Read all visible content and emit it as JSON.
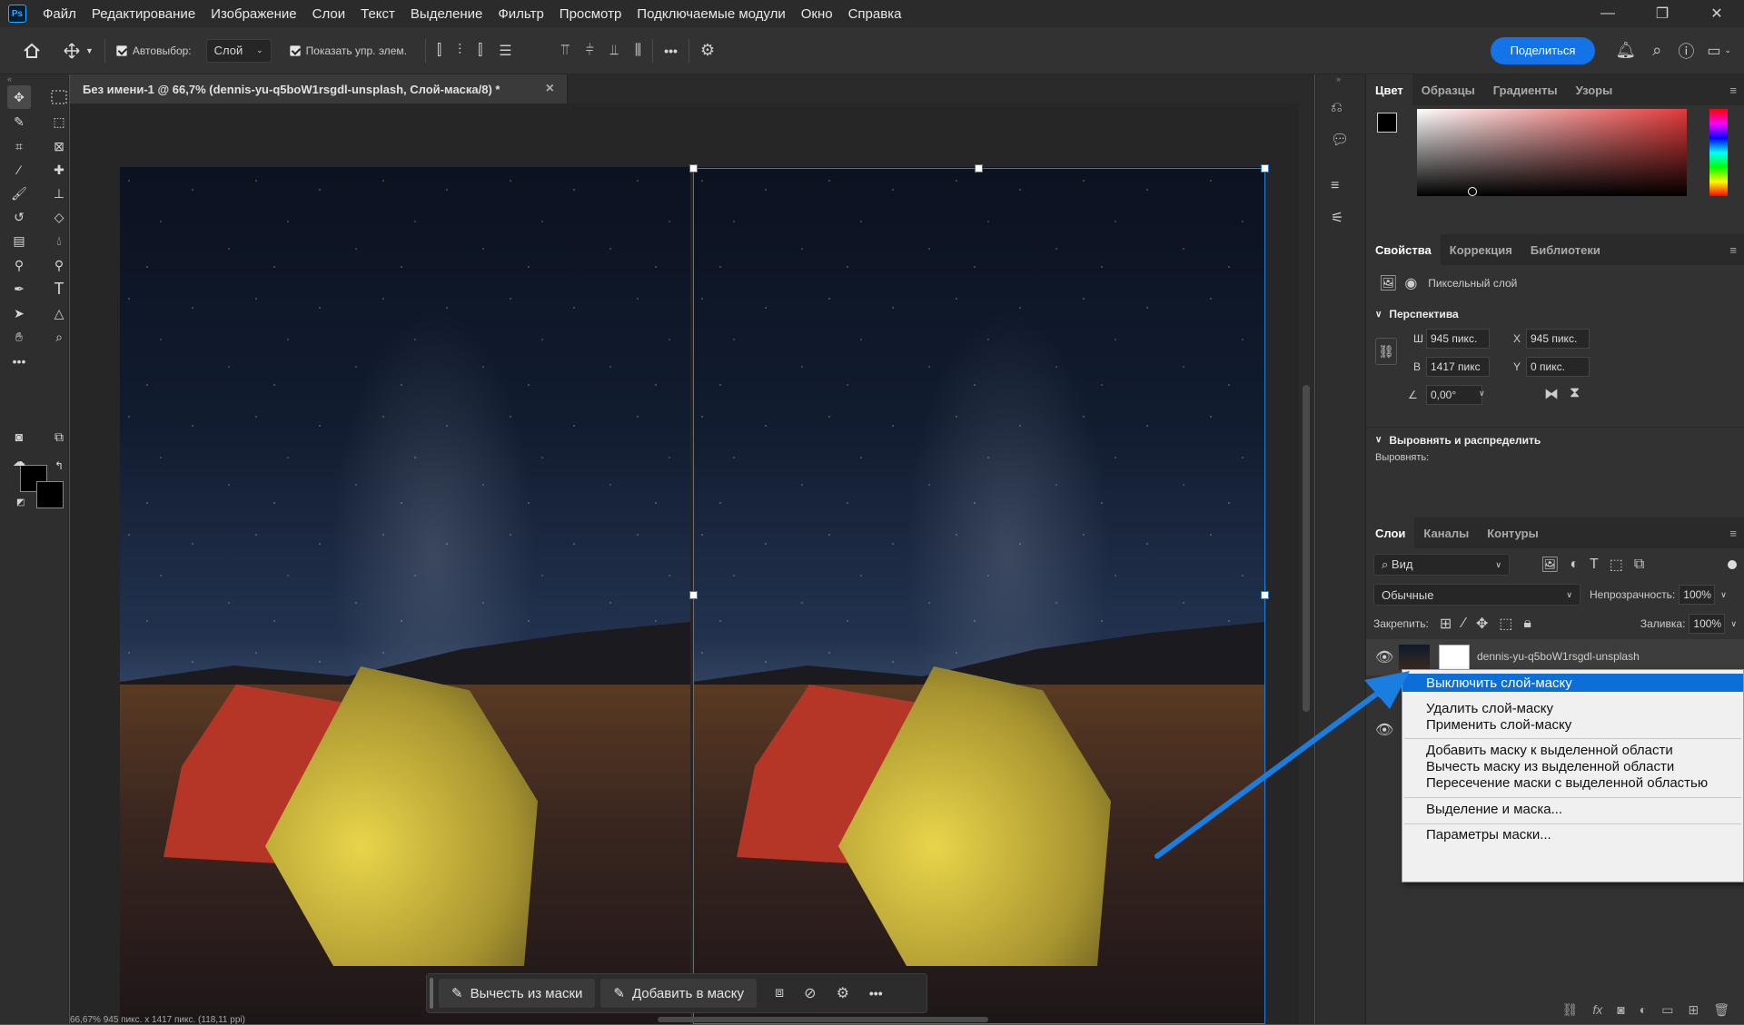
{
  "app": {
    "logo": "Ps"
  },
  "menu": [
    "Файл",
    "Редактирование",
    "Изображение",
    "Слои",
    "Текст",
    "Выделение",
    "Фильтр",
    "Просмотр",
    "Подключаемые модули",
    "Окно",
    "Справка"
  ],
  "window_controls": {
    "minimize": "—",
    "restore": "❐",
    "close": "✕"
  },
  "options": {
    "autoselect_label": "Автовыбор:",
    "autoselect_value": "Слой",
    "show_controls_label": "Показать упр. элем.",
    "more": "•••",
    "share_label": "Поделиться"
  },
  "document": {
    "tab_title": "Без имени-1 @ 66,7% (dennis-yu-q5boW1rsgdl-unsplash, Слой-маска/8) *",
    "tab_close": "×",
    "status_text": "66,67%  945 пикс. x 1417 пикс. (118,11 ppi)"
  },
  "context_bar": {
    "subtract_label": "Вычесть из маски",
    "add_label": "Добавить в маску",
    "more": "•••"
  },
  "color_panel": {
    "tabs": [
      "Цвет",
      "Образцы",
      "Градиенты",
      "Узоры"
    ],
    "active_tab": "Цвет",
    "hue_gradient_color": "#e23a3a"
  },
  "properties_panel": {
    "tabs": [
      "Свойства",
      "Коррекция",
      "Библиотеки"
    ],
    "layer_type": "Пиксельный слой",
    "section_transform": "Перспектива",
    "w_label": "Ш",
    "w_value": "945 пикс.",
    "h_label": "В",
    "h_value": "1417 пикс",
    "x_label": "X",
    "x_value": "945 пикс.",
    "y_label": "Y",
    "y_value": "0 пикс.",
    "angle_value": "0,00°",
    "section_align": "Выровнять и распределить",
    "align_label": "Выровнять:"
  },
  "layers_panel": {
    "tabs": [
      "Слои",
      "Каналы",
      "Контуры"
    ],
    "filter_value": "Вид",
    "blend_mode": "Обычные",
    "opacity_label": "Непрозрачность:",
    "opacity_value": "100%",
    "lock_label": "Закрепить:",
    "fill_label": "Заливка:",
    "fill_value": "100%",
    "layer_name": "dennis-yu-q5boW1rsgdl-unsplash"
  },
  "context_menu": {
    "items": [
      "Выключить слой-маску",
      "Удалить слой-маску",
      "Применить слой-маску",
      "Добавить маску к выделенной области",
      "Вычесть маску из выделенной области",
      "Пересечение маски с выделенной областью",
      "Выделение и маска...",
      "Параметры маски..."
    ],
    "highlighted": "Выключить слой-маску"
  },
  "colors": {
    "accent": "#1473e6",
    "arrow": "#1a7de0",
    "selection": "#1c7fe6"
  }
}
